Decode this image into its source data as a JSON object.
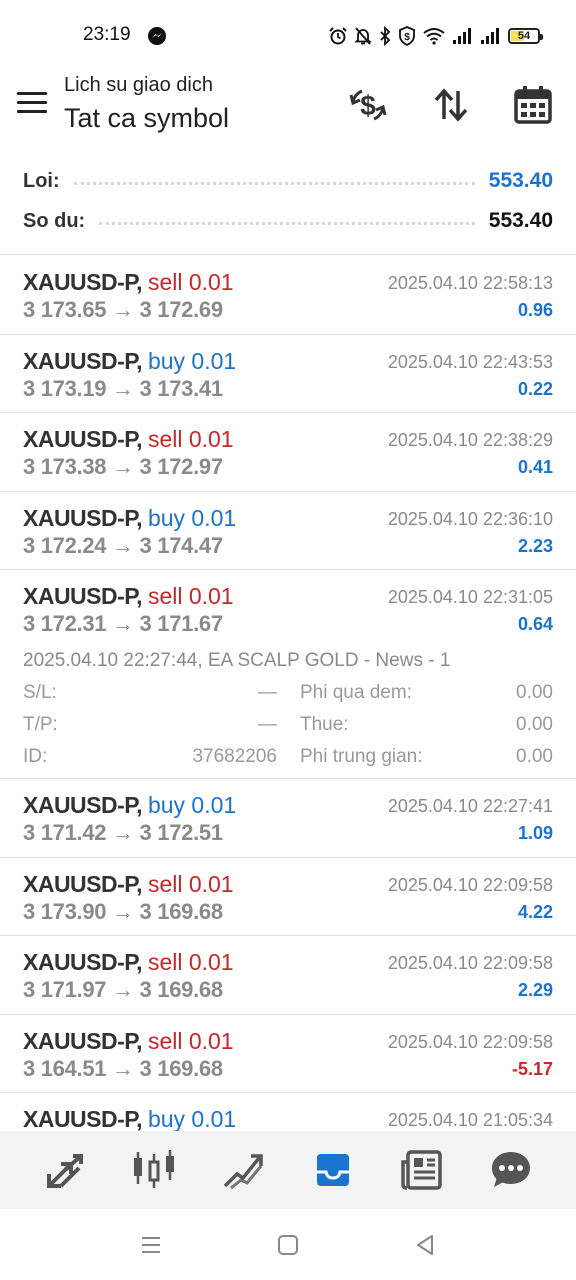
{
  "status_bar": {
    "time": "23:19",
    "battery": "54",
    "battery_level": 0.54,
    "icons": [
      "messenger-icon",
      "alarm-icon",
      "mute-icon",
      "bluetooth-icon",
      "vpn-icon",
      "wifi-icon",
      "signal-icon",
      "signal-icon",
      "battery-icon"
    ]
  },
  "header": {
    "subtitle": "Lich su giao dich",
    "title": "Tat ca symbol",
    "icons": [
      "menu-icon",
      "currency-exchange-icon",
      "sort-icon",
      "calendar-icon"
    ]
  },
  "summary": {
    "profit_label": "Loi:",
    "profit_value": "553.40",
    "balance_label": "So du:",
    "balance_value": "553.40"
  },
  "colors": {
    "sell": "#c8272a",
    "buy": "#1a73d1",
    "positive": "#1a73d1",
    "negative": "#c8272a",
    "nav_active": "#1a73d1"
  },
  "deals": [
    {
      "symbol": "XAUUSD-P,",
      "side": "sell 0.01",
      "type": "sell",
      "prices": "3 173.65 → 3 172.69",
      "time": "2025.04.10 22:58:13",
      "profit": "0.96"
    },
    {
      "symbol": "XAUUSD-P,",
      "side": "buy 0.01",
      "type": "buy",
      "prices": "3 173.19 → 3 173.41",
      "time": "2025.04.10 22:43:53",
      "profit": "0.22"
    },
    {
      "symbol": "XAUUSD-P,",
      "side": "sell 0.01",
      "type": "sell",
      "prices": "3 173.38 → 3 172.97",
      "time": "2025.04.10 22:38:29",
      "profit": "0.41"
    },
    {
      "symbol": "XAUUSD-P,",
      "side": "buy 0.01",
      "type": "buy",
      "prices": "3 172.24 → 3 174.47",
      "time": "2025.04.10 22:36:10",
      "profit": "2.23"
    },
    {
      "symbol": "XAUUSD-P,",
      "side": "sell 0.01",
      "type": "sell",
      "prices": "3 172.31 → 3 171.67",
      "time": "2025.04.10 22:31:05",
      "profit": "0.64",
      "details": {
        "open_info": "2025.04.10 22:27:44, EA SCALP GOLD - News - 1",
        "sl_label": "S/L:",
        "sl_value": "—",
        "tp_label": "T/P:",
        "tp_value": "—",
        "id_label": "ID:",
        "id_value": "37682206",
        "swap_label": "Phi qua dem:",
        "swap_value": "0.00",
        "tax_label": "Thue:",
        "tax_value": "0.00",
        "commission_label": "Phi trung gian:",
        "commission_value": "0.00"
      }
    },
    {
      "symbol": "XAUUSD-P,",
      "side": "buy 0.01",
      "type": "buy",
      "prices": "3 171.42 → 3 172.51",
      "time": "2025.04.10 22:27:41",
      "profit": "1.09"
    },
    {
      "symbol": "XAUUSD-P,",
      "side": "sell 0.01",
      "type": "sell",
      "prices": "3 173.90 → 3 169.68",
      "time": "2025.04.10 22:09:58",
      "profit": "4.22"
    },
    {
      "symbol": "XAUUSD-P,",
      "side": "sell 0.01",
      "type": "sell",
      "prices": "3 171.97 → 3 169.68",
      "time": "2025.04.10 22:09:58",
      "profit": "2.29"
    },
    {
      "symbol": "XAUUSD-P,",
      "side": "sell 0.01",
      "type": "sell",
      "prices": "3 164.51 → 3 169.68",
      "time": "2025.04.10 22:09:58",
      "profit": "-5.17"
    },
    {
      "symbol": "XAUUSD-P,",
      "side": "buy 0.01",
      "type": "buy",
      "prices": "",
      "time": "2025.04.10 21:05:34",
      "profit": ""
    }
  ],
  "bottom_nav": [
    {
      "icon": "trade-arrows-icon",
      "active": false
    },
    {
      "icon": "candlestick-chart-icon",
      "active": false
    },
    {
      "icon": "trend-chart-icon",
      "active": false
    },
    {
      "icon": "history-inbox-icon",
      "active": true
    },
    {
      "icon": "news-icon",
      "active": false
    },
    {
      "icon": "chat-icon",
      "active": false
    }
  ],
  "system_nav": [
    "recent-apps-icon",
    "home-icon",
    "back-icon"
  ]
}
